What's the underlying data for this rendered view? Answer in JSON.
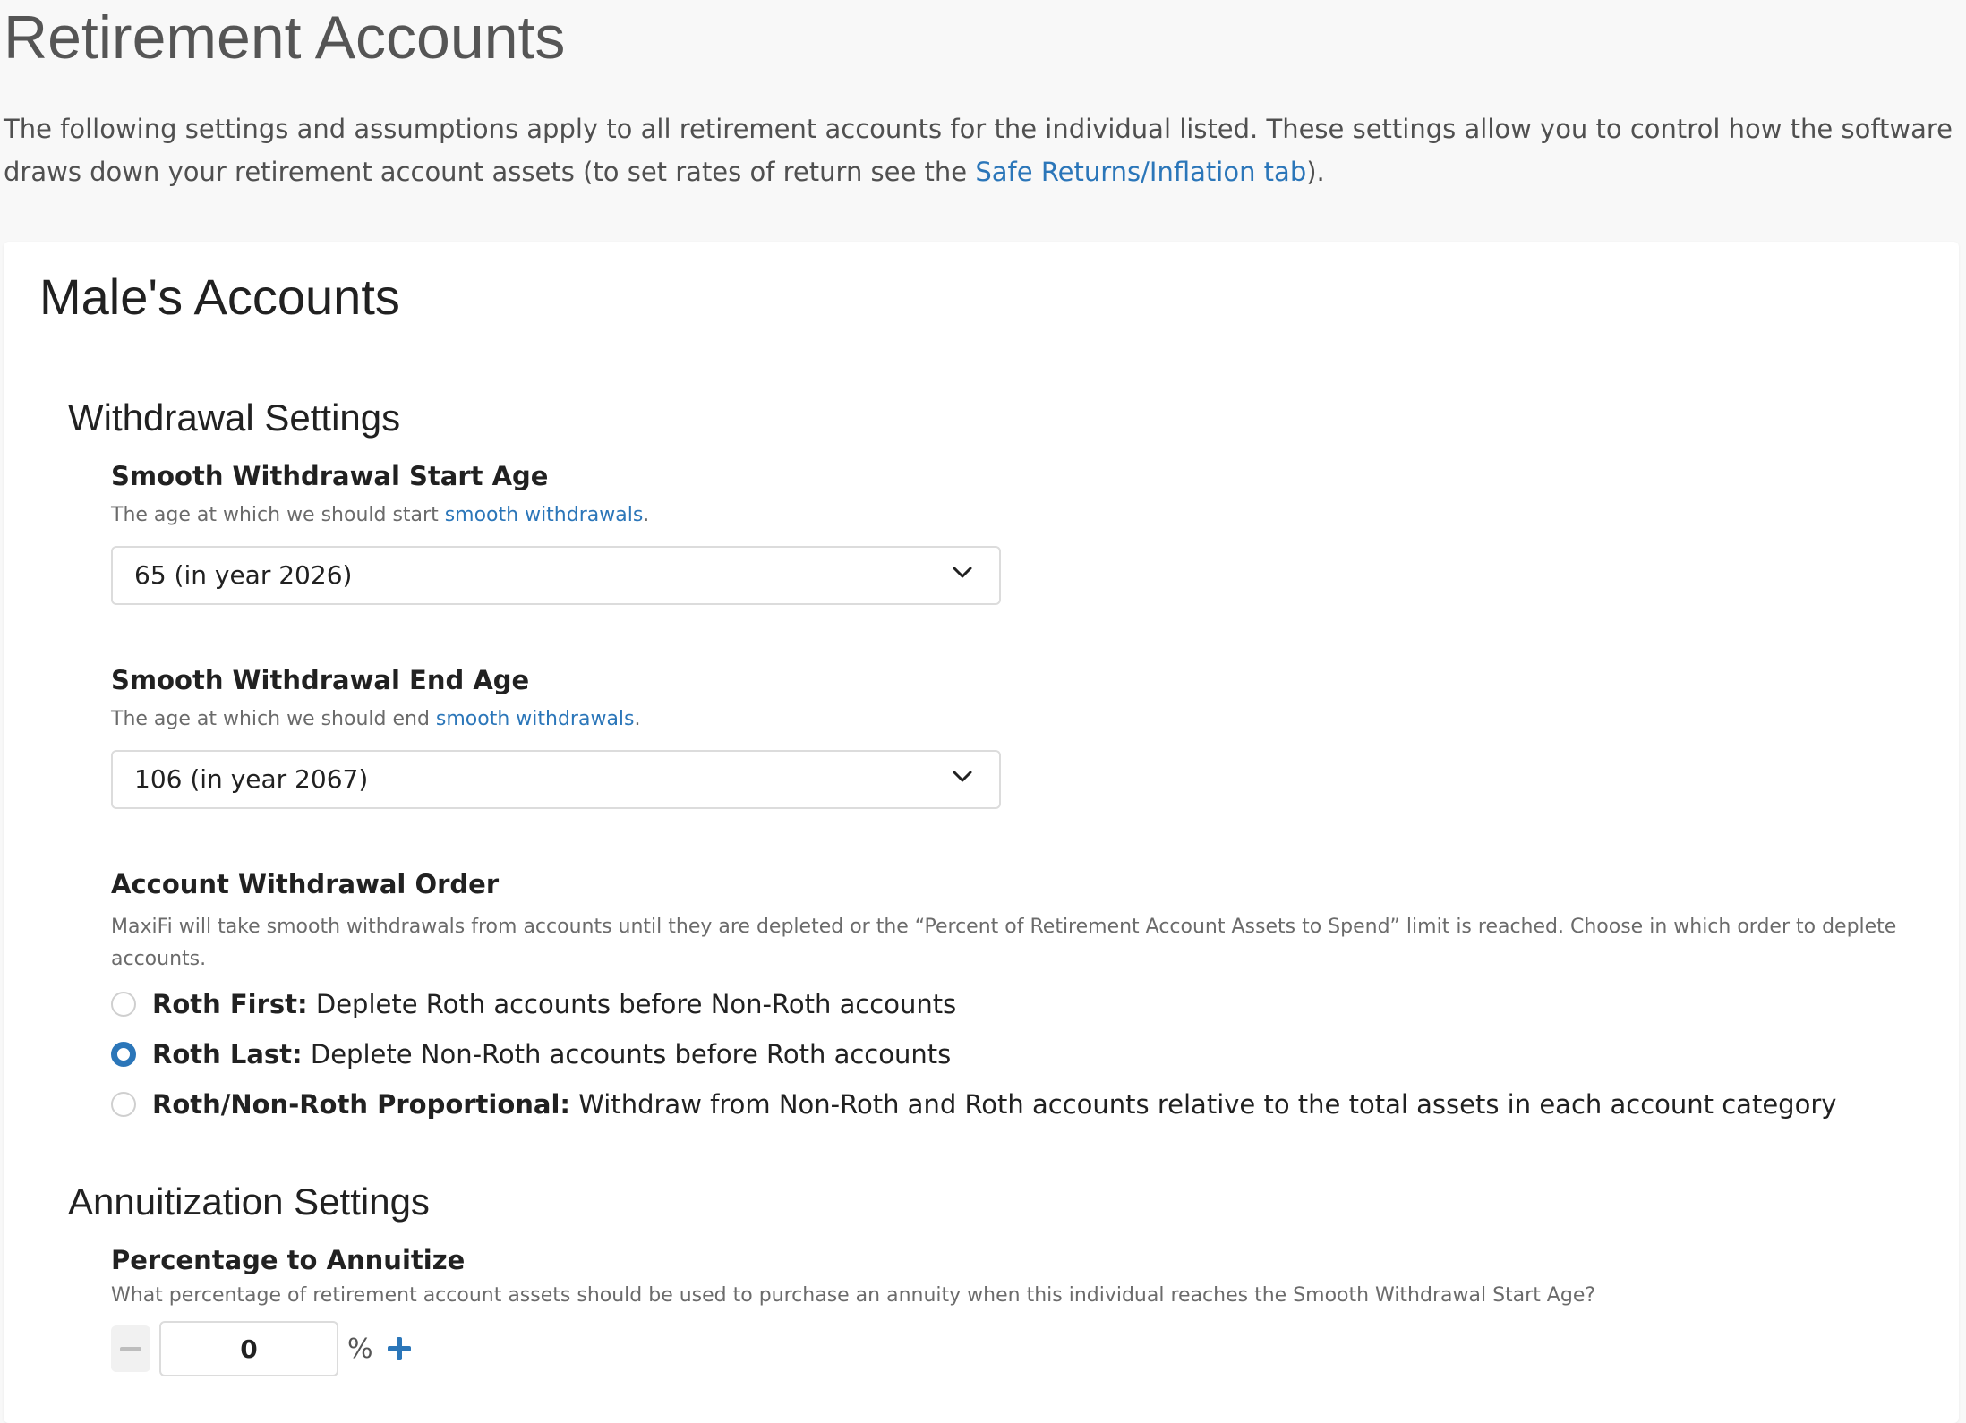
{
  "page": {
    "title": "Retirement Accounts",
    "intro_text": "The following settings and assumptions apply to all retirement accounts for the individual listed. These settings allow you to control how the software draws down your retirement account assets (to set rates of return see the ",
    "intro_link": "Safe Returns/Inflation tab",
    "intro_end": ")."
  },
  "card": {
    "title": "Male's Accounts"
  },
  "withdrawal": {
    "section_title": "Withdrawal Settings",
    "start_age": {
      "label": "Smooth Withdrawal Start Age",
      "help_text": "The age at which we should start ",
      "help_link": "smooth withdrawals",
      "help_end": ".",
      "value": "65 (in year 2026)"
    },
    "end_age": {
      "label": "Smooth Withdrawal End Age",
      "help_text": "The age at which we should end ",
      "help_link": "smooth withdrawals",
      "help_end": ".",
      "value": "106 (in year 2067)"
    },
    "order": {
      "label": "Account Withdrawal Order",
      "help_text": "MaxiFi will take smooth withdrawals from accounts until they are depleted or the “Percent of Retirement Account Assets to Spend” limit is reached. Choose in which order to deplete accounts.",
      "options": [
        {
          "title": "Roth First:",
          "desc": " Deplete Roth accounts before Non-Roth accounts",
          "selected": false
        },
        {
          "title": "Roth Last:",
          "desc": " Deplete Non-Roth accounts before Roth accounts",
          "selected": true
        },
        {
          "title": "Roth/Non-Roth Proportional:",
          "desc": " Withdraw from Non-Roth and Roth accounts relative to the total assets in each account category",
          "selected": false
        }
      ]
    }
  },
  "annuitization": {
    "section_title": "Annuitization Settings",
    "percentage": {
      "label": "Percentage to Annuitize",
      "help_text": "What percentage of retirement account assets should be used to purchase an annuity when this individual reaches the Smooth Withdrawal Start Age?",
      "value": "0",
      "unit": "%"
    }
  },
  "colors": {
    "accent": "#2b76b9",
    "background": "#f8f8f8",
    "card": "#ffffff"
  },
  "icons": {
    "dropdown": "chevron-down-icon",
    "decrement": "minus-icon",
    "increment": "plus-icon"
  }
}
